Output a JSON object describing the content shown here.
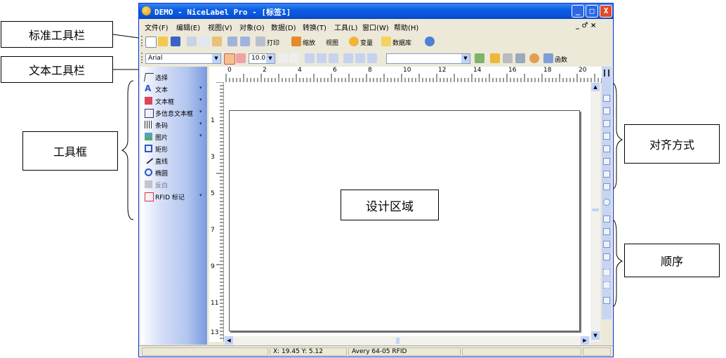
{
  "callouts": {
    "standard_toolbar": "标准工具栏",
    "text_toolbar": "文本工具栏",
    "toolbox": "工具框",
    "alignment": "对齐方式",
    "design_area": "设计区域",
    "order": "顺序"
  },
  "window": {
    "title": "DEMO - NiceLabel Pro - [标签1]",
    "controls": {
      "minimize": "_",
      "maximize": "□",
      "close": "X"
    },
    "mdi_controls": "_ ♂ ×"
  },
  "menu": {
    "items": [
      "文件(F)",
      "编辑(E)",
      "视图(V)",
      "对象(O)",
      "数据(D)",
      "转换(T)",
      "工具(L)",
      "窗口(W)",
      "帮助(H)"
    ]
  },
  "standard_toolbar": {
    "print_label": "打印",
    "zoom_label": "缩放",
    "view_label": "视图",
    "variable_label": "变量",
    "database_label": "数据库"
  },
  "text_toolbar": {
    "font_name": "Arial",
    "font_size": "10.0",
    "functions_label": "函数"
  },
  "toolbox": {
    "items": [
      {
        "label": "选择",
        "has_arrow": false
      },
      {
        "label": "文本",
        "has_arrow": true
      },
      {
        "label": "文本框",
        "has_arrow": true
      },
      {
        "label": "多信息文本框",
        "has_arrow": true
      },
      {
        "label": "条码",
        "has_arrow": true
      },
      {
        "label": "图片",
        "has_arrow": true
      },
      {
        "label": "矩形",
        "has_arrow": false
      },
      {
        "label": "直线",
        "has_arrow": false
      },
      {
        "label": "椭圆",
        "has_arrow": false
      },
      {
        "label": "反白",
        "has_arrow": false
      },
      {
        "label": "RFID 标记",
        "has_arrow": true
      }
    ]
  },
  "ruler": {
    "h_ticks": [
      "0",
      "2",
      "4",
      "6",
      "8",
      "10",
      "12",
      "14",
      "16",
      "18",
      "20"
    ],
    "v_ticks": [
      "1",
      "3",
      "5",
      "7",
      "9",
      "11",
      "13"
    ]
  },
  "statusbar": {
    "coords": "X: 19.45 Y: 5.12",
    "stock": "Avery 64-05 RFID"
  }
}
